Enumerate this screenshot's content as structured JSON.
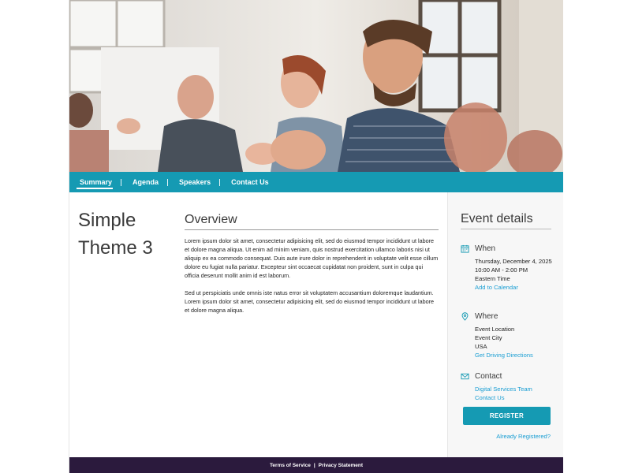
{
  "nav": {
    "items": [
      {
        "label": "Summary"
      },
      {
        "label": "Agenda"
      },
      {
        "label": "Speakers"
      },
      {
        "label": "Contact Us"
      }
    ]
  },
  "event": {
    "title": "Simple Theme 3"
  },
  "overview": {
    "heading": "Overview",
    "paragraphs": [
      "Lorem ipsum dolor sit amet, consectetur adipisicing elit, sed do eiusmod tempor incididunt ut labore et dolore magna aliqua. Ut enim ad minim veniam, quis nostrud exercitation ullamco laboris nisi ut aliquip ex ea commodo consequat. Duis aute irure dolor in reprehenderit in voluptate velit esse cillum dolore eu fugiat nulla pariatur. Excepteur sint occaecat cupidatat non proident, sunt in culpa qui officia deserunt mollit anim id est laborum.",
      "Sed ut perspiciatis unde omnis iste natus error sit voluptatem accusantium doloremque laudantium. Lorem ipsum dolor sit amet, consectetur adipisicing elit, sed do eiusmod tempor incididunt ut labore et dolore magna aliqua."
    ]
  },
  "details": {
    "heading": "Event details",
    "when": {
      "label": "When",
      "date": "Thursday, December 4, 2025",
      "time": "10:00 AM - 2:00 PM",
      "tz": "Eastern Time",
      "link": "Add to Calendar"
    },
    "where": {
      "label": "Where",
      "location": "Event Location",
      "city": "Event City",
      "country": "USA",
      "link": "Get Driving Directions"
    },
    "contact": {
      "label": "Contact",
      "team": "Digital Services Team",
      "link": "Contact Us"
    },
    "register": "REGISTER",
    "already": "Already Registered?"
  },
  "footer": {
    "terms": "Terms of Service",
    "sep": "|",
    "privacy": "Privacy Statement"
  },
  "colors": {
    "accent": "#159ab3",
    "link": "#1a9ed3",
    "footer": "#2b1a3d"
  },
  "icons": {
    "when": "calendar-icon",
    "where": "location-pin-icon",
    "contact": "envelope-icon"
  }
}
